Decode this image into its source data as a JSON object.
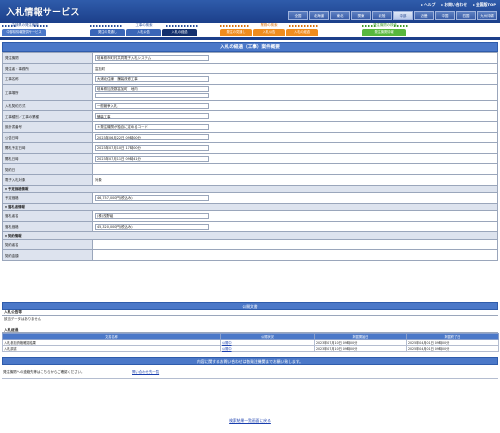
{
  "header": {
    "title": "入札情報サービス",
    "links": [
      "ヘルプ",
      "お問い合わせ",
      "全国版TOP"
    ],
    "regions": [
      "全国",
      "北海道",
      "東北",
      "関東",
      "北陸",
      "中部",
      "近畿",
      "中国",
      "四国",
      "九州沖縄"
    ],
    "active_region": "中部"
  },
  "nav": {
    "groups": [
      {
        "title": "中部県の発注機関",
        "tabs": [
          "中部県情報提供サービス"
        ]
      },
      {
        "title": "工事の検索",
        "tabs": [
          "発注の見通し",
          "入札公告",
          "入札の経過"
        ]
      },
      {
        "title": "業務の検索",
        "tabs": [
          "発注の見通し",
          "入札公告",
          "入札の経過"
        ]
      },
      {
        "title": "発注機関の検索",
        "tabs": [
          "発注機関情報"
        ]
      }
    ]
  },
  "detail": {
    "title": "入札の経過（工事）案件概要",
    "rows": [
      {
        "label": "発注機関",
        "value": "岐阜県市町村共同電子入札システム"
      },
      {
        "label": "発注者・事務所",
        "value": "富加町"
      },
      {
        "label": "工事名称",
        "value": "大浦北住線　舗装改修工事"
      },
      {
        "label": "工事場所",
        "value": "岐阜県加茂郡富加町　地内",
        "value2": ""
      },
      {
        "label": "入札契約方式",
        "value": "一般競争入札"
      },
      {
        "label": "工事種別／工事の業種",
        "value": "舗装工事"
      },
      {
        "label": "設計書番号",
        "value": "＊発注機関が独自に定めるコード"
      },
      {
        "label": "公告日時",
        "value": "2023年06月22日 09時00分"
      },
      {
        "label": "開札予定日時",
        "value": "2023年07月10日 17時00分"
      },
      {
        "label": "開札日時",
        "value": "2023年07月11日 09時41分"
      },
      {
        "label": "契約日",
        "value": ""
      },
      {
        "label": "電子入札対象",
        "value": "対象"
      }
    ],
    "price_group": "予定価格情報",
    "price_label": "予定価格",
    "price_value": "46,757,000円(税込み)",
    "winner_group": "落札者情報",
    "winner_name_label": "落札者名",
    "winner_name": "(株)浅野組",
    "winner_price_label": "落札価格",
    "winner_price": "45,320,000円(税込み)",
    "contract_group": "契約情報",
    "contractor_label": "契約者名",
    "contractor_value": "",
    "contract_amount_label": "契約金額",
    "contract_amount_value": ""
  },
  "docs": {
    "title": "公開文書",
    "notice_title": "入札公告等",
    "notice_empty": "該当データはありません",
    "result_title": "入札経過",
    "columns": [
      "文書名称",
      "公開状況",
      "掲載開始日",
      "掲載終了日"
    ],
    "rows": [
      {
        "name": "入札参加資格確認結果",
        "status": "公開中",
        "start": "2023年07月10日 09時00分",
        "end": "2025年04月01日 09時00分"
      },
      {
        "name": "入札調書",
        "status": "公開中",
        "start": "2023年07月10日 09時00分",
        "end": "2025年04月01日 09時00分"
      }
    ]
  },
  "contact": {
    "title": "内容に関するお問い合わせは各発注機関までお願い致します。",
    "text": "発注機関への連絡先等はこちらからご確認ください。",
    "link": "問い合わせ先一覧"
  },
  "back_link": "検索結果一覧画面に戻る",
  "colors": {
    "header": "#1c3f8a",
    "accent": "#4b78c8",
    "label_bg": "#dde3ee",
    "orange": "#ef8c1e",
    "green": "#58b73d"
  }
}
